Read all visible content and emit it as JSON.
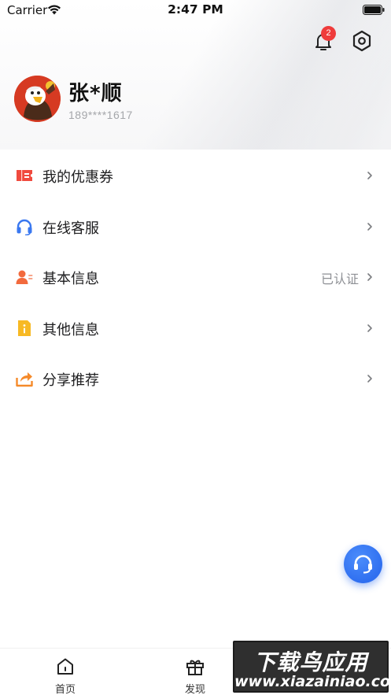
{
  "status_bar": {
    "carrier": "Carrier",
    "time": "2:47 PM"
  },
  "header": {
    "notification_count": "2",
    "icons": [
      "bell-icon",
      "settings-icon"
    ]
  },
  "profile": {
    "name": "张*顺",
    "phone": "189****1617"
  },
  "menu": [
    {
      "label": "我的优惠券",
      "value": "",
      "icon": "coupon-icon",
      "color": "#f04a3e"
    },
    {
      "label": "在线客服",
      "value": "",
      "icon": "headset-icon",
      "color": "#3a78f0"
    },
    {
      "label": "基本信息",
      "value": "已认证",
      "icon": "user-info-icon",
      "color": "#f26a3d"
    },
    {
      "label": "其他信息",
      "value": "",
      "icon": "info-doc-icon",
      "color": "#f7b924"
    },
    {
      "label": "分享推荐",
      "value": "",
      "icon": "share-icon",
      "color": "#f58a2a"
    }
  ],
  "tabbar": {
    "home": "首页",
    "discover": "发现"
  },
  "watermark": {
    "title": "下载鸟应用",
    "url": "www.xiazainiao.com"
  },
  "colors": {
    "accent": "#2f6ff0",
    "badge": "#ef3b3b",
    "muted": "#a5a7ab"
  }
}
